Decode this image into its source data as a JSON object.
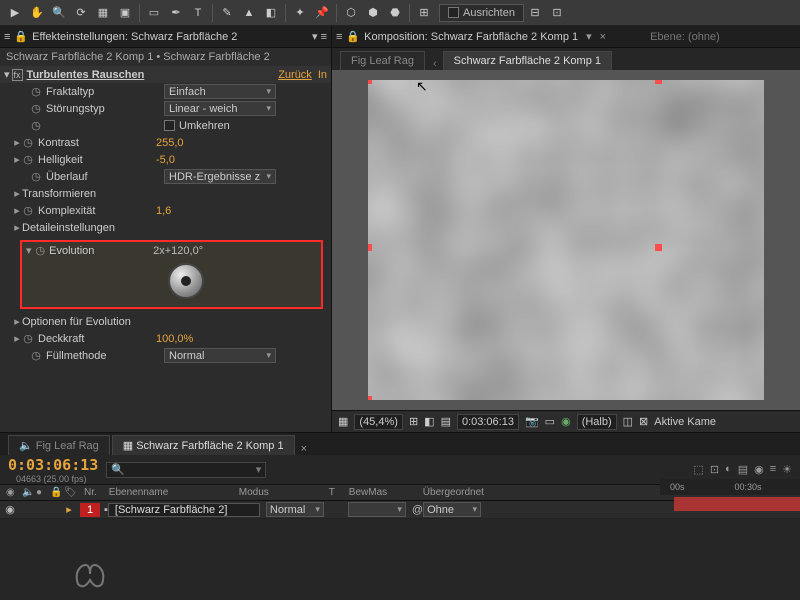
{
  "toolbar": {
    "ausrichten": "Ausrichten"
  },
  "effects_panel": {
    "title": "Effekteinstellungen: Schwarz Farbfläche 2",
    "breadcrumb": "Schwarz Farbfläche 2 Komp 1 • Schwarz Farbfläche 2",
    "effect_name": "Turbulentes Rauschen",
    "reset": "Zurück",
    "info": "In",
    "props": {
      "fraktaltyp": {
        "label": "Fraktaltyp",
        "value": "Einfach"
      },
      "stoerungstyp": {
        "label": "Störungstyp",
        "value": "Linear - weich"
      },
      "umkehren": {
        "label": "Umkehren"
      },
      "kontrast": {
        "label": "Kontrast",
        "value": "255,0"
      },
      "helligkeit": {
        "label": "Helligkeit",
        "value": "-5,0"
      },
      "ueberlauf": {
        "label": "Überlauf",
        "value": "HDR-Ergebnisse z"
      },
      "transformieren": {
        "label": "Transformieren"
      },
      "komplexitaet": {
        "label": "Komplexität",
        "value": "1,6"
      },
      "detail": {
        "label": "Detaileinstellungen"
      },
      "evolution": {
        "label": "Evolution",
        "value": "2x+120,0°"
      },
      "optionen": {
        "label": "Optionen für Evolution"
      },
      "deckkraft": {
        "label": "Deckkraft",
        "value": "100,0%"
      },
      "fuellmethode": {
        "label": "Füllmethode",
        "value": "Normal"
      }
    }
  },
  "comp_panel": {
    "title": "Komposition: Schwarz Farbfläche 2 Komp 1",
    "ebene": "Ebene: (ohne)",
    "tabs": {
      "inactive": "Fig Leaf Rag",
      "active": "Schwarz Farbfläche 2 Komp 1"
    },
    "footer": {
      "zoom": "(45,4%)",
      "time": "0:03:06:13",
      "res": "(Halb)",
      "camera": "Aktive Kame"
    }
  },
  "timeline": {
    "tabs": {
      "inactive": "Fig Leaf Rag",
      "active": "Schwarz Farbfläche 2 Komp 1"
    },
    "timecode": "0:03:06:13",
    "fps": "04663 (25.00 fps)",
    "cols": {
      "nr": "Nr.",
      "ebenenname": "Ebenenname",
      "modus": "Modus",
      "t": "T",
      "bewmas": "BewMas",
      "uebergeordnet": "Übergeordnet"
    },
    "layer": {
      "num": "1",
      "name": "[Schwarz Farbfläche 2]",
      "mode": "Normal",
      "parent": "Ohne"
    },
    "ruler": {
      "t0": "00s",
      "t30": "00:30s"
    }
  }
}
